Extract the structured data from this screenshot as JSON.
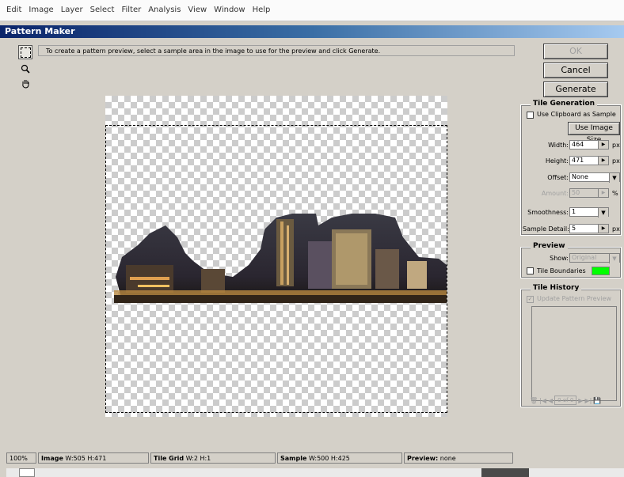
{
  "menu": [
    "Edit",
    "Image",
    "Layer",
    "Select",
    "Filter",
    "Analysis",
    "View",
    "Window",
    "Help"
  ],
  "dialog_title": "Pattern Maker",
  "instruction": "To create a pattern preview, select a sample area in the image to use for the preview and click Generate.",
  "buttons": {
    "ok": "OK",
    "cancel": "Cancel",
    "generate": "Generate"
  },
  "tile_generation": {
    "title": "Tile Generation",
    "use_clipboard": "Use Clipboard as Sample",
    "use_image_size": "Use Image Size",
    "width_label": "Width:",
    "width_value": "464",
    "width_unit": "px",
    "height_label": "Height:",
    "height_value": "471",
    "height_unit": "px",
    "offset_label": "Offset:",
    "offset_value": "None",
    "amount_label": "Amount:",
    "amount_value": "50",
    "amount_unit": "%",
    "smoothness_label": "Smoothness:",
    "smoothness_value": "1",
    "sample_detail_label": "Sample Detail:",
    "sample_detail_value": "5",
    "sample_detail_unit": "px"
  },
  "preview": {
    "title": "Preview",
    "show_label": "Show:",
    "show_value": "Original",
    "tile_boundaries": "Tile Boundaries",
    "boundary_color": "#00ff00"
  },
  "tile_history": {
    "title": "Tile History",
    "update_preview": "Update Pattern Preview",
    "counter": "0 of 0"
  },
  "status": {
    "zoom": "100%",
    "image_label": "Image",
    "image_value": "W:505 H:471",
    "tile_grid_label": "Tile Grid",
    "tile_grid_value": "W:2 H:1",
    "sample_label": "Sample",
    "sample_value": "W:500 H:425",
    "preview_label": "Preview:",
    "preview_value": "none"
  }
}
